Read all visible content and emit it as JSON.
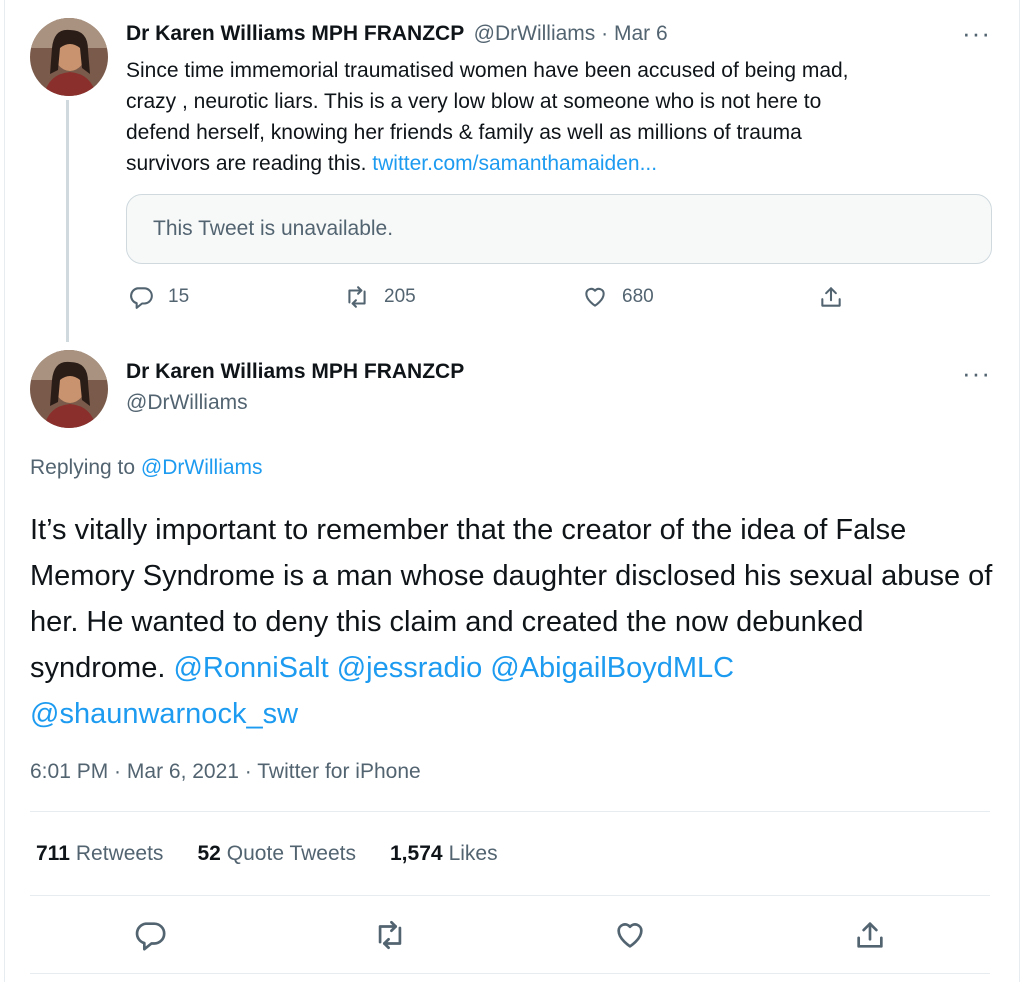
{
  "tweet1": {
    "name": "Dr Karen Williams MPH FRANZCP",
    "handle": "@DrWilliams",
    "separator": "·",
    "date": "Mar 6",
    "more_label": "···",
    "text_lines": [
      "Since time immemorial traumatised women have been accused of being mad,",
      "crazy , neurotic liars. This is a very low blow at someone who is not here to",
      "defend herself, knowing her friends & family as well as millions of trauma",
      "survivors are reading this. "
    ],
    "link_text": "twitter.com/samanthamaiden...",
    "quote_unavailable": "This Tweet is unavailable.",
    "reply_count": "15",
    "retweet_count": "205",
    "like_count": "680"
  },
  "tweet2": {
    "name": "Dr Karen Williams MPH FRANZCP",
    "handle": "@DrWilliams",
    "more_label": "···",
    "replying_prefix": "Replying to ",
    "replying_to": "@DrWilliams",
    "text": "It’s vitally important to remember that the creator of the idea of False Memory Syndrome is a man whose daughter disclosed his sexual abuse of her. He wanted to deny this claim and created the now debunked syndrome. ",
    "mentions": [
      "@RonniSalt",
      "@jessradio",
      "@AbigailBoydMLC",
      "@shaunwarnock_sw"
    ],
    "time": "6:01 PM",
    "date": "Mar 6, 2021",
    "source": "Twitter for iPhone",
    "meta_separator": " · ",
    "stats": {
      "retweets_count": "711",
      "retweets_label": "Retweets",
      "quotes_count": "52",
      "quotes_label": "Quote Tweets",
      "likes_count": "1,574",
      "likes_label": "Likes"
    }
  },
  "icons": [
    "reply-icon",
    "retweet-icon",
    "like-icon",
    "share-icon",
    "more-icon"
  ],
  "colors": {
    "link": "#1d9bf0",
    "muted": "#536471",
    "text": "#0f1419",
    "border": "#cfd9de"
  }
}
